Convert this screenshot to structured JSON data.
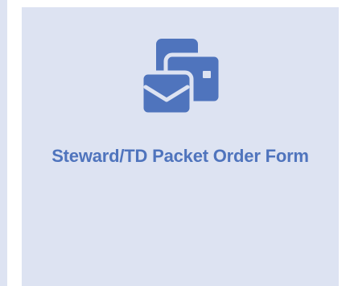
{
  "tile": {
    "label": "Steward/TD Packet Order Form",
    "icon": "mail-packet-icon",
    "accent_color": "#4f74bd",
    "background_color": "#dde3f2"
  }
}
